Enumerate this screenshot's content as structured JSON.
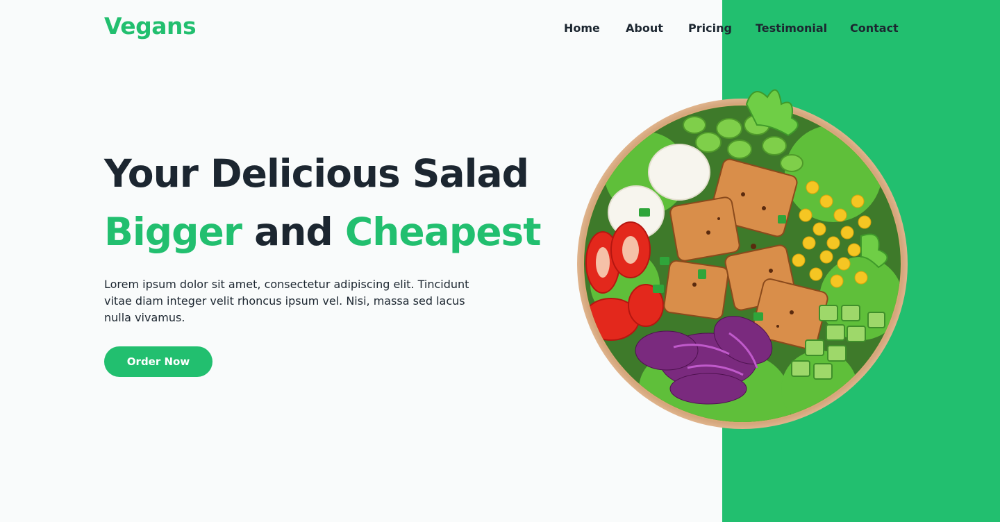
{
  "brand": {
    "logo": "Vegans",
    "accent": "#22bf6f",
    "text_color": "#1c2630"
  },
  "nav": {
    "items": [
      {
        "label": "Home"
      },
      {
        "label": "About"
      },
      {
        "label": "Pricing"
      },
      {
        "label": "Testimonial"
      },
      {
        "label": "Contact"
      }
    ]
  },
  "hero": {
    "title_line1": "Your Delicious Salad",
    "title_line2_part1": "Bigger",
    "title_line2_part2": "and",
    "title_line2_part3": "Cheapest",
    "description": "Lorem ipsum dolor sit amet, consectetur adipiscing elit. Tincidunt vitae diam integer velit rhoncus ipsum vel. Nisi, massa sed lacus nulla vivamus.",
    "cta_label": "Order Now"
  },
  "image": {
    "subject": "salad-bowl"
  }
}
